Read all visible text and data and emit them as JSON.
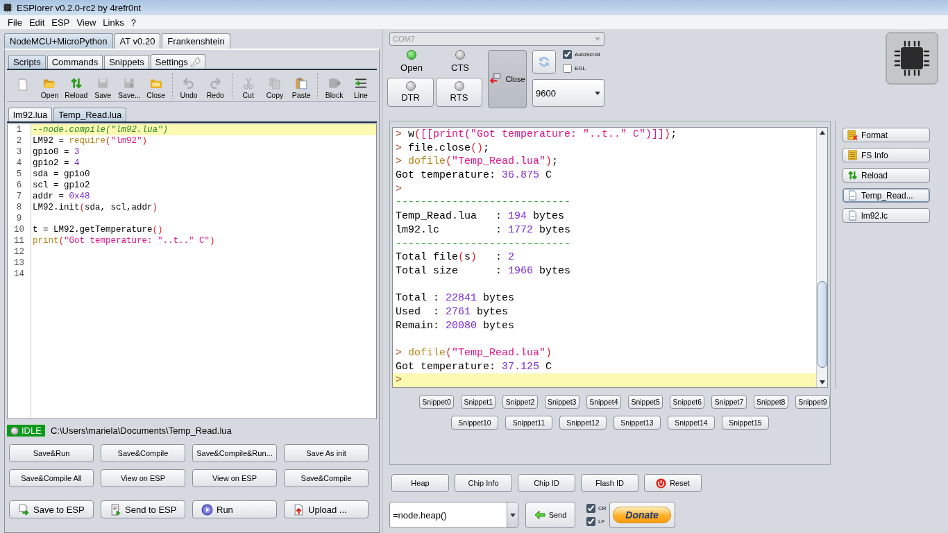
{
  "window": {
    "title": "ESPlorer v0.2.0-rc2 by 4refr0nt"
  },
  "menu": [
    "File",
    "Edit",
    "ESP",
    "View",
    "Links",
    "?"
  ],
  "firmware_tabs": [
    {
      "label": "NodeMCU+MicroPython",
      "selected": true
    },
    {
      "label": "AT v0.20",
      "selected": false
    },
    {
      "label": "Frankenshtein",
      "selected": false
    }
  ],
  "script_tabs": [
    {
      "label": "Scripts",
      "selected": true,
      "kind": "plain"
    },
    {
      "label": "Commands",
      "selected": false,
      "kind": "plain"
    },
    {
      "label": "Snippets",
      "selected": false,
      "kind": "plain"
    },
    {
      "label": "Settings",
      "selected": false,
      "kind": "tool"
    }
  ],
  "toolbar": [
    {
      "kind": "new",
      "disabled": false
    },
    {
      "label": "Open",
      "kind": "open",
      "disabled": false
    },
    {
      "label": "Reload",
      "kind": "reload",
      "disabled": false
    },
    {
      "label": "Save",
      "kind": "save",
      "disabled": true
    },
    {
      "label": "Save...",
      "kind": "saveas",
      "disabled": true
    },
    {
      "label": "Close",
      "kind": "close",
      "disabled": false
    },
    {
      "label": "Undo",
      "kind": "undo",
      "disabled": true
    },
    {
      "label": "Redo",
      "kind": "redo",
      "disabled": true
    },
    {
      "label": "Cut",
      "kind": "cut",
      "disabled": true
    },
    {
      "label": "Copy",
      "kind": "copy",
      "disabled": true
    },
    {
      "label": "Paste",
      "kind": "paste",
      "disabled": false
    },
    {
      "label": "Block",
      "kind": "block",
      "disabled": true
    },
    {
      "label": "Line",
      "kind": "line",
      "disabled": false
    }
  ],
  "file_tabs": [
    {
      "label": "lm92.lua",
      "selected": false
    },
    {
      "label": "Temp_Read.lua",
      "selected": true
    }
  ],
  "editor": {
    "lines": [
      {
        "number": "1",
        "current": true,
        "tokens": [
          {
            "kind": "comment",
            "text": "--node.compile(\"lm92.lua\")"
          }
        ]
      },
      {
        "number": "2",
        "current": false,
        "tokens": [
          {
            "kind": "text",
            "text": "LM92 = "
          },
          {
            "kind": "func",
            "text": "require"
          },
          {
            "kind": "paren",
            "text": "("
          },
          {
            "kind": "string",
            "text": "\"lm92\""
          },
          {
            "kind": "paren",
            "text": ")"
          }
        ]
      },
      {
        "number": "3",
        "current": false,
        "tokens": [
          {
            "kind": "text",
            "text": "gpio0 = "
          },
          {
            "kind": "number",
            "text": "3"
          }
        ]
      },
      {
        "number": "4",
        "current": false,
        "tokens": [
          {
            "kind": "text",
            "text": "gpio2 = "
          },
          {
            "kind": "number",
            "text": "4"
          }
        ]
      },
      {
        "number": "5",
        "current": false,
        "tokens": [
          {
            "kind": "text",
            "text": "sda = gpio0"
          }
        ]
      },
      {
        "number": "6",
        "current": false,
        "tokens": [
          {
            "kind": "text",
            "text": "scl = gpio2"
          }
        ]
      },
      {
        "number": "7",
        "current": false,
        "tokens": [
          {
            "kind": "text",
            "text": "addr = "
          },
          {
            "kind": "number",
            "text": "0x48"
          }
        ]
      },
      {
        "number": "8",
        "current": false,
        "tokens": [
          {
            "kind": "text",
            "text": "LM92.init"
          },
          {
            "kind": "paren",
            "text": "("
          },
          {
            "kind": "text",
            "text": "sda, scl,addr"
          },
          {
            "kind": "paren",
            "text": ")"
          }
        ]
      },
      {
        "number": "9",
        "current": false
      },
      {
        "number": "10",
        "current": false,
        "tokens": [
          {
            "kind": "text",
            "text": "t = LM92.getTemperature"
          },
          {
            "kind": "paren",
            "text": "()"
          }
        ]
      },
      {
        "number": "11",
        "current": false,
        "tokens": [
          {
            "kind": "func",
            "text": "print"
          },
          {
            "kind": "paren",
            "text": "("
          },
          {
            "kind": "string",
            "text": "\"Got temperature: \"..t..\" C\""
          },
          {
            "kind": "paren",
            "text": ")"
          }
        ]
      },
      {
        "number": "12",
        "current": false
      },
      {
        "number": "13",
        "current": false
      },
      {
        "number": "14",
        "current": false
      }
    ]
  },
  "status": {
    "state": "IDLE",
    "path": "C:\\Users\\mariela\\Documents\\Temp_Read.lua"
  },
  "script_buttons": [
    "Save&Run",
    "Save&Compile",
    "Save&Compile&Run...",
    "Save As init",
    "Save&Compile All",
    "View on ESP",
    "View on ESP",
    "Save&Compile"
  ],
  "action_buttons": [
    {
      "label": "Save to ESP",
      "kind": "save-esp"
    },
    {
      "label": "Send to ESP",
      "kind": "send-esp"
    },
    {
      "label": "Run",
      "kind": "run"
    },
    {
      "label": "Upload ...",
      "kind": "upload"
    }
  ],
  "port": {
    "value": "COM7",
    "disabled": true
  },
  "signals": [
    {
      "label": "Open",
      "on": true,
      "kind": "led"
    },
    {
      "label": "CTS",
      "on": false,
      "kind": "led"
    },
    {
      "label": "DTR",
      "on": false,
      "kind": "button"
    },
    {
      "label": "RTS",
      "on": false,
      "kind": "button"
    }
  ],
  "connect_button": {
    "label": "Close"
  },
  "refresh_button": {
    "disabled": true
  },
  "options": [
    {
      "label": "AutoScroll",
      "checked": true
    },
    {
      "label": "EOL",
      "checked": false
    }
  ],
  "baud": {
    "value": "9600"
  },
  "console": {
    "lines": [
      {
        "current": false,
        "tokens": [
          {
            "kind": "prompt",
            "text": "> "
          },
          {
            "kind": "text",
            "text": "w"
          },
          {
            "kind": "paren",
            "text": "("
          },
          {
            "kind": "string",
            "text": "[[print(\"Got temperature: \"..t..\" C\")]]"
          },
          {
            "kind": "paren",
            "text": ")"
          },
          {
            "kind": "text",
            "text": ";"
          }
        ]
      },
      {
        "current": false,
        "tokens": [
          {
            "kind": "prompt",
            "text": "> "
          },
          {
            "kind": "text",
            "text": "file.close"
          },
          {
            "kind": "paren",
            "text": "()"
          },
          {
            "kind": "text",
            "text": ";"
          }
        ]
      },
      {
        "current": false,
        "tokens": [
          {
            "kind": "prompt",
            "text": "> "
          },
          {
            "kind": "func",
            "text": "dofile"
          },
          {
            "kind": "paren",
            "text": "("
          },
          {
            "kind": "string",
            "text": "\"Temp_Read.lua\""
          },
          {
            "kind": "paren",
            "text": ")"
          },
          {
            "kind": "text",
            "text": ";"
          }
        ]
      },
      {
        "current": false,
        "tokens": [
          {
            "kind": "text",
            "text": "Got temperature: "
          },
          {
            "kind": "number",
            "text": "36.875"
          },
          {
            "kind": "text",
            "text": " C"
          }
        ]
      },
      {
        "current": false,
        "tokens": [
          {
            "kind": "prompt",
            "text": ">"
          }
        ]
      },
      {
        "current": false,
        "tokens": [
          {
            "kind": "rule",
            "text": "----------------------------"
          }
        ]
      },
      {
        "current": false,
        "tokens": [
          {
            "kind": "text",
            "text": "Temp_Read.lua   : "
          },
          {
            "kind": "number",
            "text": "194"
          },
          {
            "kind": "text",
            "text": " bytes"
          }
        ]
      },
      {
        "current": false,
        "tokens": [
          {
            "kind": "text",
            "text": "lm92.lc         : "
          },
          {
            "kind": "number",
            "text": "1772"
          },
          {
            "kind": "text",
            "text": " bytes"
          }
        ]
      },
      {
        "current": false,
        "tokens": [
          {
            "kind": "rule",
            "text": "----------------------------"
          }
        ]
      },
      {
        "current": false,
        "tokens": [
          {
            "kind": "text",
            "text": "Total file"
          },
          {
            "kind": "paren",
            "text": "("
          },
          {
            "kind": "text",
            "text": "s"
          },
          {
            "kind": "paren",
            "text": ")"
          },
          {
            "kind": "text",
            "text": "   : "
          },
          {
            "kind": "number",
            "text": "2"
          }
        ]
      },
      {
        "current": false,
        "tokens": [
          {
            "kind": "text",
            "text": "Total size      : "
          },
          {
            "kind": "number",
            "text": "1966"
          },
          {
            "kind": "text",
            "text": " bytes"
          }
        ]
      },
      {
        "current": false
      },
      {
        "current": false,
        "tokens": [
          {
            "kind": "text",
            "text": "Total : "
          },
          {
            "kind": "number",
            "text": "22841"
          },
          {
            "kind": "text",
            "text": " bytes"
          }
        ]
      },
      {
        "current": false,
        "tokens": [
          {
            "kind": "text",
            "text": "Used  : "
          },
          {
            "kind": "number",
            "text": "2761"
          },
          {
            "kind": "text",
            "text": " bytes"
          }
        ]
      },
      {
        "current": false,
        "tokens": [
          {
            "kind": "text",
            "text": "Remain: "
          },
          {
            "kind": "number",
            "text": "20080"
          },
          {
            "kind": "text",
            "text": " bytes"
          }
        ]
      },
      {
        "current": false
      },
      {
        "current": false,
        "tokens": [
          {
            "kind": "prompt",
            "text": "> "
          },
          {
            "kind": "func",
            "text": "dofile"
          },
          {
            "kind": "paren",
            "text": "("
          },
          {
            "kind": "string",
            "text": "\"Temp_Read.lua\""
          },
          {
            "kind": "paren",
            "text": ")"
          }
        ]
      },
      {
        "current": false,
        "tokens": [
          {
            "kind": "text",
            "text": "Got temperature: "
          },
          {
            "kind": "number",
            "text": "37.125"
          },
          {
            "kind": "text",
            "text": " C"
          }
        ]
      },
      {
        "current": true,
        "tokens": [
          {
            "kind": "prompt",
            "text": ">"
          }
        ]
      }
    ]
  },
  "file_buttons": [
    {
      "label": "Format",
      "kind": "format",
      "selected": false
    },
    {
      "label": "FS Info",
      "kind": "fsinfo",
      "selected": false
    },
    {
      "label": "Reload",
      "kind": "reload",
      "selected": false
    },
    {
      "label": "Temp_Read...",
      "kind": "file",
      "selected": true
    },
    {
      "label": "lm92.lc",
      "kind": "file",
      "selected": false
    }
  ],
  "snippets": [
    "Snippet0",
    "Snippet1",
    "Snippet2",
    "Snippet3",
    "Snippet4",
    "Snippet5",
    "Snippet6",
    "Snippet7",
    "Snippet8",
    "Snippet9",
    "Snippet10",
    "Snippet11",
    "Snippet12",
    "Snippet13",
    "Snippet14",
    "Snippet15"
  ],
  "commands": [
    {
      "label": "Heap",
      "kind": "plain"
    },
    {
      "label": "Chip Info",
      "kind": "plain"
    },
    {
      "label": "Chip ID",
      "kind": "plain"
    },
    {
      "label": "Flash ID",
      "kind": "plain"
    },
    {
      "label": "Reset",
      "kind": "power"
    }
  ],
  "command_input": {
    "value": "=node.heap()"
  },
  "send_button": {
    "label": "Send"
  },
  "line_endings": [
    {
      "label": "CR",
      "checked": true
    },
    {
      "label": "LF",
      "checked": true
    }
  ],
  "donate_button": {
    "label": "Donate"
  }
}
